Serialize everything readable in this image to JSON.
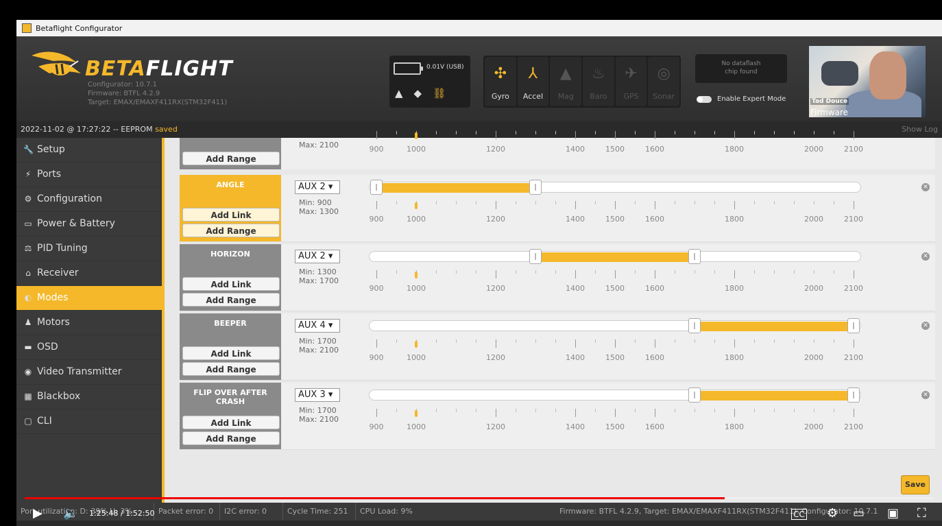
{
  "window": {
    "title": "Betaflight Configurator"
  },
  "logo": {
    "beta": "BETA",
    "flight": "FLIGHT"
  },
  "header": {
    "configurator": "Configurator: 10.7.1",
    "firmware": "Firmware: BTFL 4.2.9",
    "target": "Target: EMAX/EMAXF411RX(STM32F411)",
    "battery_label": "0.01V (USB)",
    "sensors": [
      {
        "label": "Gyro",
        "icon": "gyro-icon",
        "active": true
      },
      {
        "label": "Accel",
        "icon": "accel-icon",
        "active": true
      },
      {
        "label": "Mag",
        "icon": "mag-icon",
        "active": false
      },
      {
        "label": "Baro",
        "icon": "baro-icon",
        "active": false
      },
      {
        "label": "GPS",
        "icon": "gps-icon",
        "active": false
      },
      {
        "label": "Sonar",
        "icon": "sonar-icon",
        "active": false
      }
    ],
    "dataflash_line1": "No dataflash",
    "dataflash_line2": "chip found",
    "expert_mode_label": "Enable Expert Mode"
  },
  "webcam": {
    "name": "Tad Douce",
    "caption": "Firmware"
  },
  "statusline": {
    "prefix": "2022-11-02 @ 17:27:22 -- EEPROM ",
    "saved": "saved",
    "show_log": "Show Log"
  },
  "sidebar": {
    "items": [
      {
        "label": "Setup",
        "icon": "wrench-icon",
        "active": false
      },
      {
        "label": "Ports",
        "icon": "plug-icon",
        "active": false
      },
      {
        "label": "Configuration",
        "icon": "gear-icon",
        "active": false
      },
      {
        "label": "Power & Battery",
        "icon": "battery-icon",
        "active": false
      },
      {
        "label": "PID Tuning",
        "icon": "pid-icon",
        "active": false
      },
      {
        "label": "Receiver",
        "icon": "receiver-icon",
        "active": false
      },
      {
        "label": "Modes",
        "icon": "modes-icon",
        "active": true
      },
      {
        "label": "Motors",
        "icon": "motor-icon",
        "active": false
      },
      {
        "label": "OSD",
        "icon": "osd-icon",
        "active": false
      },
      {
        "label": "Video Transmitter",
        "icon": "vtx-icon",
        "active": false
      },
      {
        "label": "Blackbox",
        "icon": "blackbox-icon",
        "active": false
      },
      {
        "label": "CLI",
        "icon": "cli-icon",
        "active": false
      }
    ]
  },
  "scale": {
    "labels": [
      "900",
      "1000",
      "1200",
      "1400",
      "1500",
      "1600",
      "1800",
      "2000",
      "2100"
    ]
  },
  "top_remnant": {
    "max": "Max: 2100",
    "add_range": "Add Range"
  },
  "modes": [
    {
      "name": "ANGLE",
      "aux": "AUX 2 ▾",
      "min": "Min: 900",
      "max": "Max: 1300",
      "range_min": 900,
      "range_max": 1300,
      "add_link": "Add Link",
      "add_range": "Add Range",
      "active": true
    },
    {
      "name": "HORIZON",
      "aux": "AUX 2 ▾",
      "min": "Min: 1300",
      "max": "Max: 1700",
      "range_min": 1300,
      "range_max": 1700,
      "add_link": "Add Link",
      "add_range": "Add Range",
      "active": false
    },
    {
      "name": "BEEPER",
      "aux": "AUX 4 ▾",
      "min": "Min: 1700",
      "max": "Max: 2100",
      "range_min": 1700,
      "range_max": 2100,
      "add_link": "Add Link",
      "add_range": "Add Range",
      "active": false
    },
    {
      "name": "FLIP OVER AFTER CRASH",
      "aux": "AUX 3 ▾",
      "min": "Min: 1700",
      "max": "Max: 2100",
      "range_min": 1700,
      "range_max": 2100,
      "add_link": "Add Link",
      "add_range": "Add Range",
      "active": false
    }
  ],
  "save_label": "Save",
  "bottombar": {
    "port_util": "Port utilization: D: 39% U: 3%",
    "packet_error": "Packet error: 0",
    "i2c_error": "I2C error: 0",
    "cycle_time": "Cycle Time: 251",
    "cpu_load": "CPU Load: 9%",
    "firmware_info": "Firmware: BTFL 4.2.9, Target: EMAX/EMAXF411RX(STM32F411), Configurator: 10.7.1"
  },
  "player": {
    "time": "1:25:48 / 1:52:50",
    "progress": 0.77
  }
}
